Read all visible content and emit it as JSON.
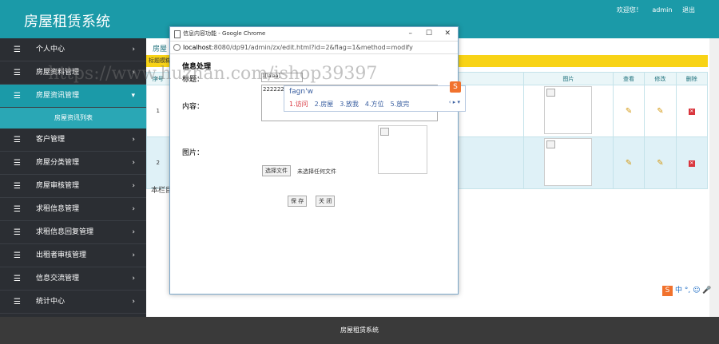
{
  "header": {
    "title": "房屋租赁系统",
    "welcome": "欢迎您！",
    "user": "admin",
    "logout": "退出"
  },
  "sidebar": {
    "items": [
      {
        "label": "个人中心"
      },
      {
        "label": "房屋资料管理"
      },
      {
        "label": "房屋资讯管理"
      },
      {
        "label": "客户管理"
      },
      {
        "label": "房屋分类管理"
      },
      {
        "label": "房屋审核管理"
      },
      {
        "label": "求租信息管理"
      },
      {
        "label": "求租信息回复管理"
      },
      {
        "label": "出租者审核管理"
      },
      {
        "label": "信息交流管理"
      },
      {
        "label": "统计中心"
      }
    ],
    "active_sub": "房屋资讯列表"
  },
  "content": {
    "crumb": "房屋",
    "warn": "标题模糊",
    "columns": [
      "序号",
      "图片",
      "查看",
      "修改",
      "删除"
    ],
    "rows": [
      {
        "index": "1"
      },
      {
        "index": "2"
      }
    ],
    "pager": "本栏目"
  },
  "popup": {
    "window_title": "信息内容功能 - Google Chrome",
    "url_host": "localhost",
    "url_rest": ":8080/dp91/admin/zx/edit.html?id=2&flag=1&method=modify",
    "heading": "信息处理",
    "label_title": "标题：",
    "title_value": "1[lalaa]",
    "label_content": "内容：",
    "content_value": "2222222",
    "label_image": "图片：",
    "choose_file": "选择文件",
    "no_file": "未选择任何文件",
    "save": "保 存",
    "close": "关 闭",
    "win_min": "–",
    "win_max": "☐",
    "win_close": "✕"
  },
  "ime": {
    "composition": "fagn'w",
    "candidates": [
      "1.访问",
      "2.房屋",
      "3.放我",
      "4.方位",
      "5.放完"
    ],
    "logo": "S",
    "bar": "中 °, ☺ 🎤"
  },
  "watermark": "https://www.huzhan.com/ishop39397",
  "footer": "房屋租赁系统"
}
